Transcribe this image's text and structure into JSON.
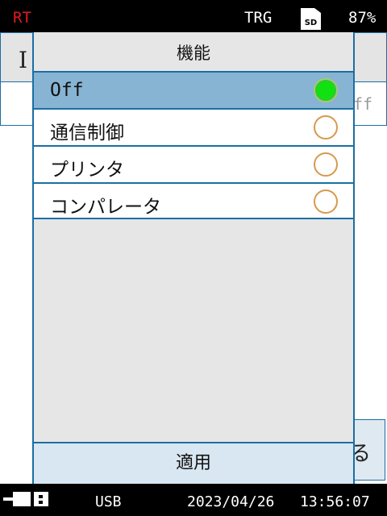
{
  "status_bar": {
    "mode": "RT",
    "trigger": "TRG",
    "sd_label": "SD",
    "battery": "87%",
    "mode_color": "#e21b1b"
  },
  "background_page": {
    "row1_char": "I",
    "row2_value": "ff",
    "button_char": "る"
  },
  "popup": {
    "title": "機能",
    "options": [
      {
        "label": "Off",
        "selected": true
      },
      {
        "label": "通信制御",
        "selected": false
      },
      {
        "label": "プリンタ",
        "selected": false
      },
      {
        "label": "コンパレータ",
        "selected": false
      }
    ],
    "apply_label": "適用",
    "accent_color": "#1a6fa4",
    "selected_row_color": "#88b4d3",
    "radio_on_color": "#11e011"
  },
  "bottom_bar": {
    "icon": "usb-connection-icon",
    "connection": "USB",
    "date": "2023/04/26",
    "time": "13:56:07"
  }
}
